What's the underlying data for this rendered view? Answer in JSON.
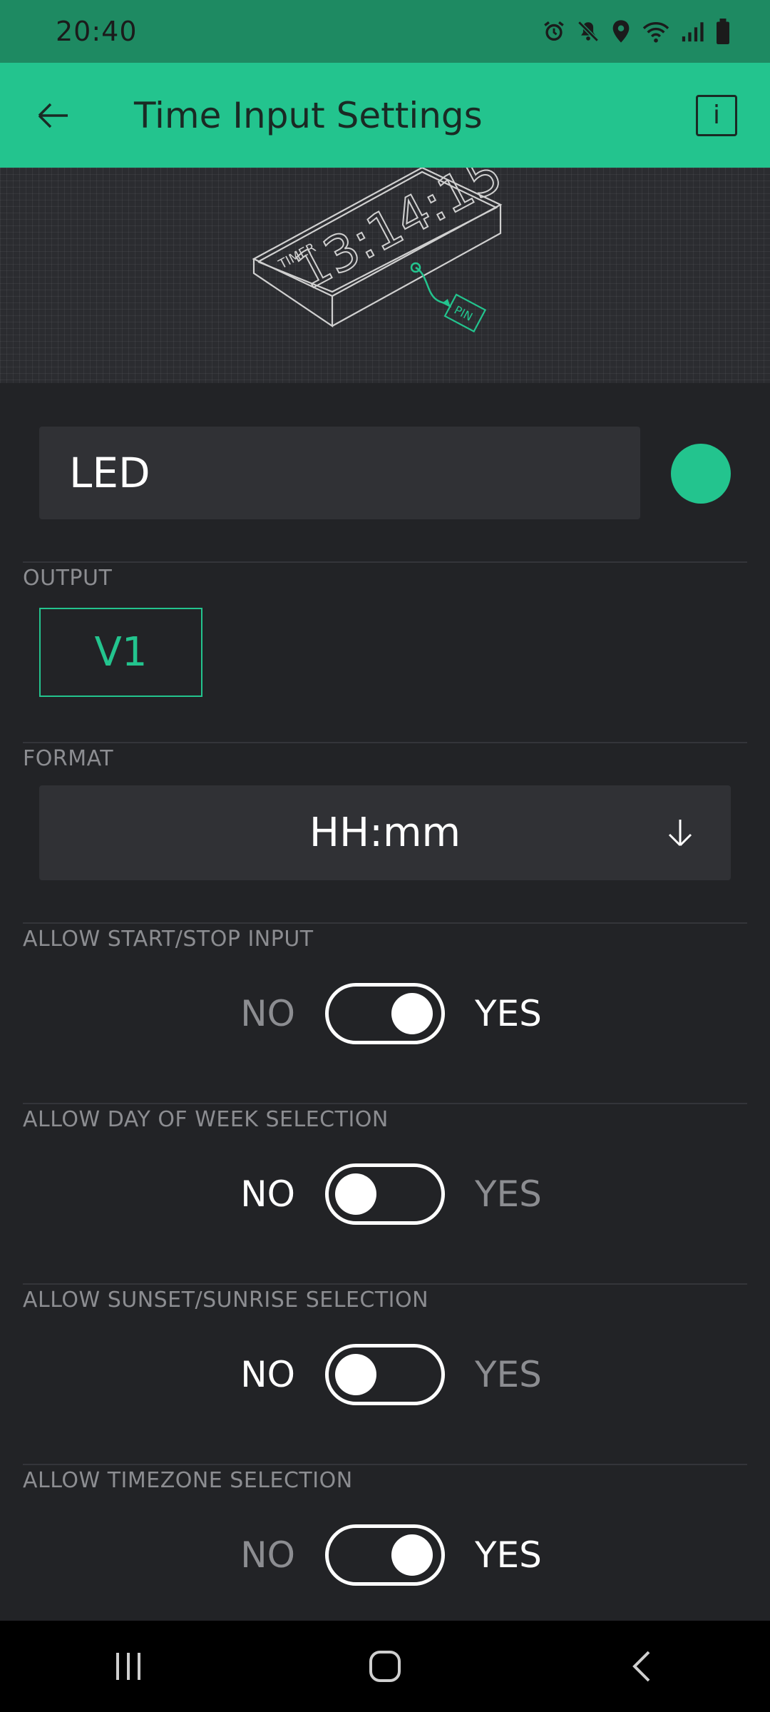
{
  "status_bar": {
    "time": "20:40",
    "icons": [
      "alarm-icon",
      "mute-icon",
      "location-icon",
      "wifi-icon",
      "signal-icon",
      "battery-icon"
    ]
  },
  "app_bar": {
    "title": "Time Input Settings",
    "back_icon": "back-arrow-icon",
    "info_label": "i"
  },
  "banner": {
    "timer_label": "TIMER",
    "time_display": "13:14:15",
    "pin_label": "PIN"
  },
  "widget": {
    "name": "LED",
    "color": "#23c48e"
  },
  "output": {
    "label": "OUTPUT",
    "pin": "V1"
  },
  "format": {
    "label": "FORMAT",
    "value": "HH:mm"
  },
  "toggles": [
    {
      "label": "ALLOW START/STOP INPUT",
      "no": "NO",
      "yes": "YES",
      "on": true
    },
    {
      "label": "ALLOW DAY OF WEEK SELECTION",
      "no": "NO",
      "yes": "YES",
      "on": false
    },
    {
      "label": "ALLOW SUNSET/SUNRISE SELECTION",
      "no": "NO",
      "yes": "YES",
      "on": false
    },
    {
      "label": "ALLOW TIMEZONE SELECTION",
      "no": "NO",
      "yes": "YES",
      "on": true
    }
  ],
  "colors": {
    "accent": "#23c48e",
    "status_bar": "#1e8a62",
    "background": "#222326",
    "field": "#303135",
    "muted_text": "#8c8d91"
  },
  "nav_bar": {
    "items": [
      "recent-apps-icon",
      "home-icon",
      "back-icon"
    ]
  }
}
